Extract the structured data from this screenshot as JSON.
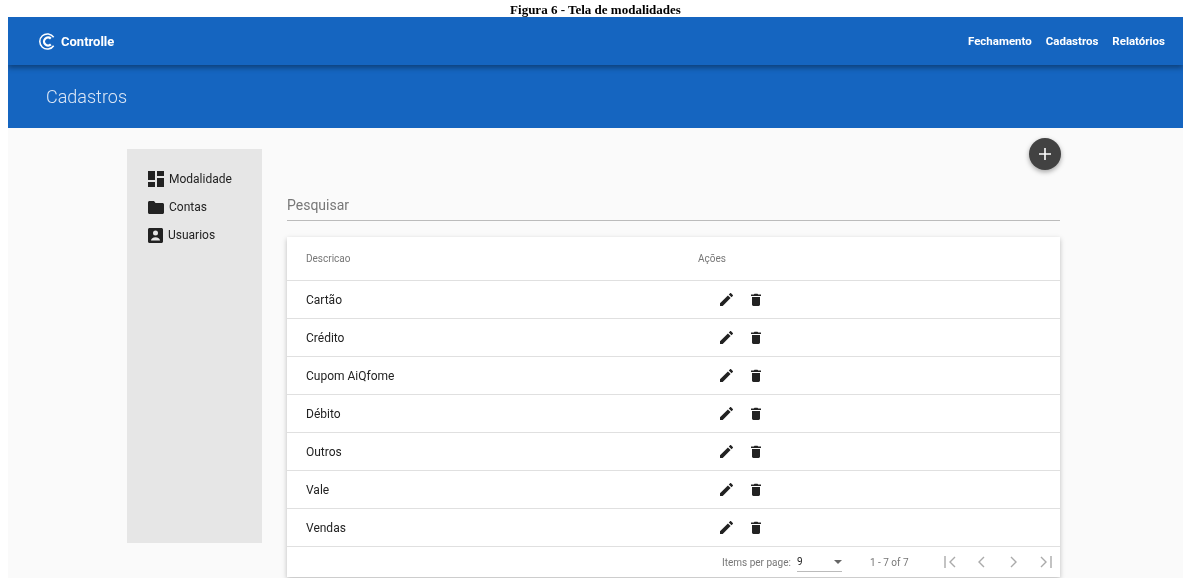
{
  "caption": "Figura 6 - Tela de modalidades",
  "toolbar": {
    "brand": "Controlle",
    "nav": [
      "Fechamento",
      "Cadastros",
      "Relatórios"
    ]
  },
  "page_title": "Cadastros",
  "sidebar": {
    "items": [
      {
        "label": "Modalidade"
      },
      {
        "label": "Contas"
      },
      {
        "label": "Usuarios"
      }
    ]
  },
  "search": {
    "placeholder": "Pesquisar"
  },
  "table": {
    "columns": [
      "Descricao",
      "Ações"
    ],
    "rows": [
      {
        "descricao": "Cartão"
      },
      {
        "descricao": "Crédito"
      },
      {
        "descricao": "Cupom AiQfome"
      },
      {
        "descricao": "Débito"
      },
      {
        "descricao": "Outros"
      },
      {
        "descricao": "Vale"
      },
      {
        "descricao": "Vendas"
      }
    ]
  },
  "paginator": {
    "items_label": "Items per page:",
    "page_size": "9",
    "range": "1 - 7 of 7",
    "buttons": [
      {
        "kind": "first",
        "disabled": true
      },
      {
        "kind": "prev",
        "disabled": true
      },
      {
        "kind": "next",
        "disabled": true
      },
      {
        "kind": "last",
        "disabled": true
      }
    ]
  }
}
